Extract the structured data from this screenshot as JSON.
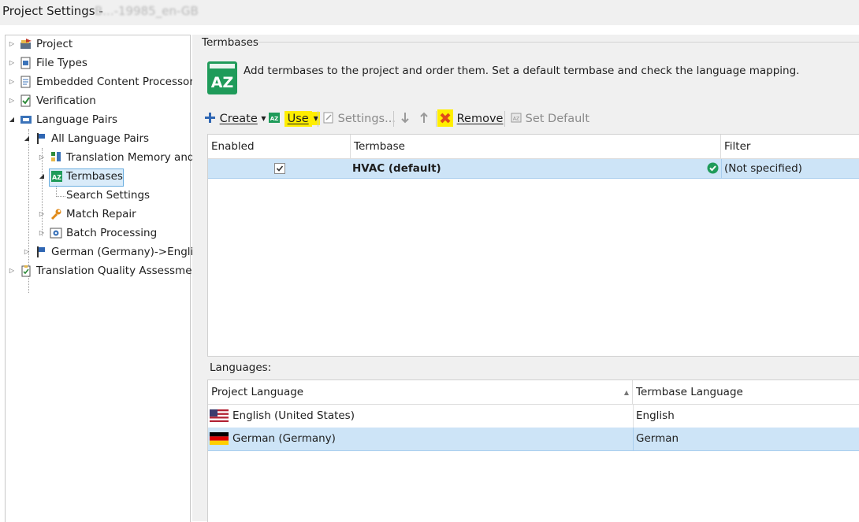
{
  "window": {
    "title": "Project Settings - ",
    "title_obscured": "B...-19985_en-GB"
  },
  "tree": {
    "items": [
      {
        "label": "Project",
        "icon": "project-icon"
      },
      {
        "label": "File Types",
        "icon": "file-types-icon"
      },
      {
        "label": "Embedded Content Processor",
        "icon": "embedded-content-icon"
      },
      {
        "label": "Verification",
        "icon": "verification-icon"
      },
      {
        "label": "Language Pairs",
        "icon": "language-pairs-icon"
      },
      {
        "label": "All Language Pairs",
        "icon": "flag-icon"
      },
      {
        "label": "Translation Memory and",
        "icon": "translation-memory-icon"
      },
      {
        "label": "Termbases",
        "icon": "termbase-icon",
        "selected": true
      },
      {
        "label": "Search Settings",
        "icon": ""
      },
      {
        "label": "Match Repair",
        "icon": "wrench-icon"
      },
      {
        "label": "Batch Processing",
        "icon": "batch-processing-icon"
      },
      {
        "label": "German (Germany)->Englis",
        "icon": "flag-icon"
      },
      {
        "label": "Translation Quality Assessmen",
        "icon": "clipboard-check-icon"
      }
    ]
  },
  "section": {
    "title": "Termbases",
    "description": "Add termbases to the project and order them. Set a default termbase and check the language mapping."
  },
  "toolbar": {
    "create": "Create",
    "use": "Use",
    "settings": "Settings...",
    "remove": "Remove",
    "set_default": "Set Default"
  },
  "termbases_grid": {
    "columns": [
      "Enabled",
      "Termbase",
      "Filter"
    ],
    "rows": [
      {
        "enabled": true,
        "termbase": "HVAC (default)",
        "filter": "(Not specified)",
        "status": "ok"
      }
    ]
  },
  "languages": {
    "label": "Languages:",
    "columns": [
      "Project Language",
      "Termbase Language"
    ],
    "rows": [
      {
        "project_language": "English (United States)",
        "termbase_language": "English",
        "flag": "us-flag"
      },
      {
        "project_language": "German (Germany)",
        "termbase_language": "German",
        "flag": "de-flag"
      }
    ]
  },
  "colors": {
    "highlight": "#ffee00",
    "selection": "#cde4f7",
    "termbase_green": "#1f9b5a",
    "remove_red": "#e04a1a"
  }
}
